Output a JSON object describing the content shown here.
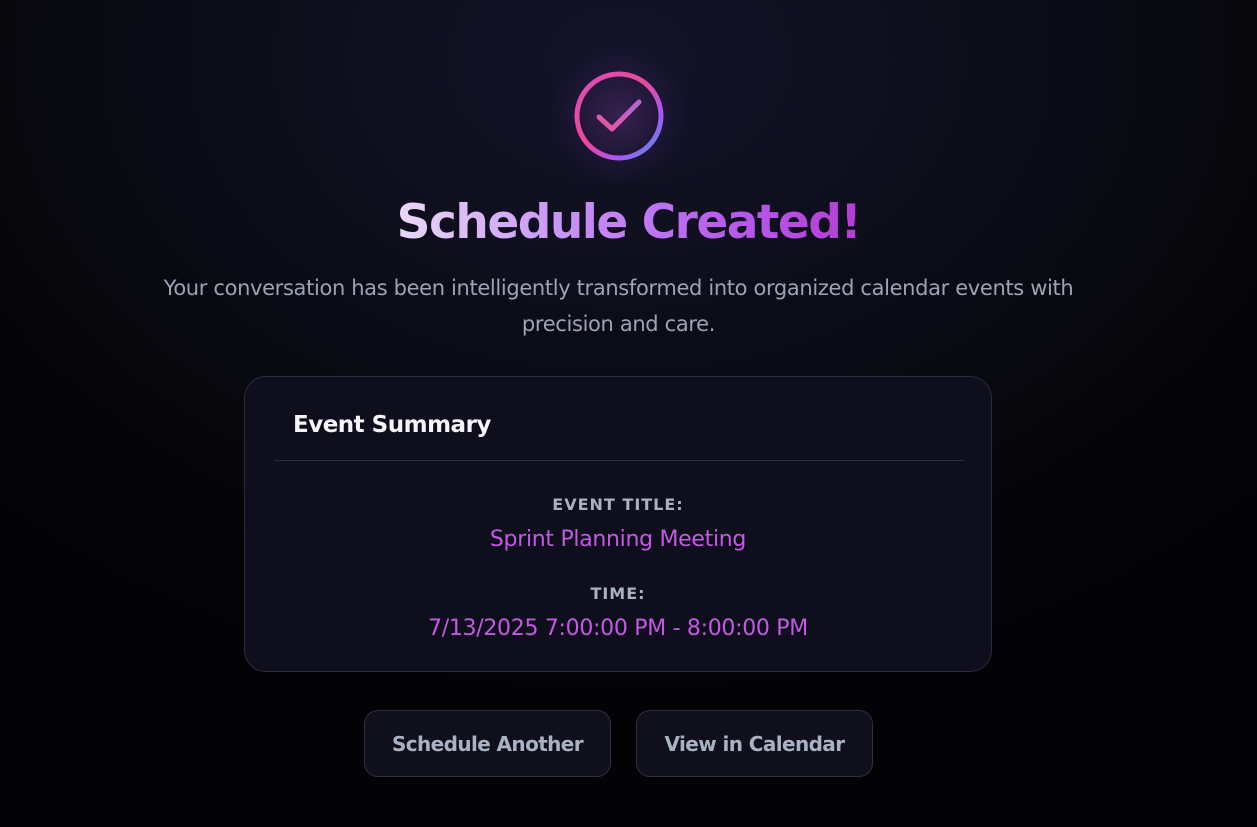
{
  "hero": {
    "icon": "check-circle-icon",
    "title": "Schedule Created!",
    "subtitle": "Your conversation has been intelligently transformed into organized calendar events with precision and care."
  },
  "summary": {
    "heading": "Event Summary",
    "title_label": "EVENT TITLE:",
    "title_value": "Sprint Planning Meeting",
    "time_label": "TIME:",
    "time_value": "7/13/2025 7:00:00 PM - 8:00:00 PM"
  },
  "actions": {
    "schedule_another": "Schedule Another",
    "view_calendar": "View in Calendar"
  },
  "colors": {
    "background": "#050508",
    "card": "#0e0e1d",
    "accent_pink": "#ec4899",
    "accent_purple": "#a855f7",
    "accent_blue": "#3b9ad9",
    "value_text": "#c35ae2",
    "muted_text": "#9ba4b4"
  }
}
